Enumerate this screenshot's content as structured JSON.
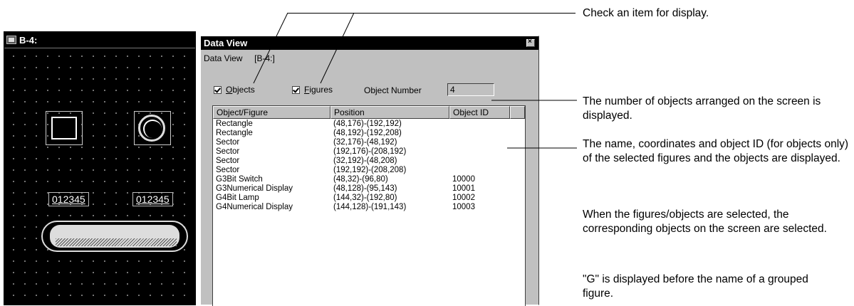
{
  "editor": {
    "title": "B-4:",
    "numerical_display_1": "012345",
    "numerical_display_2": "012345"
  },
  "dialog": {
    "title": "Data View",
    "path": "Data View     [B-4:]",
    "close_glyph": "×",
    "objects_label": "Objects",
    "objects_checked": true,
    "figures_label": "Figures",
    "figures_checked": true,
    "object_number_label": "Object Number",
    "object_number_value": "4",
    "columns": [
      "Object/Figure",
      "Position",
      "Object ID",
      ""
    ],
    "rows": [
      {
        "name": "Rectangle",
        "position": "(48,176)-(192,192)",
        "id": ""
      },
      {
        "name": "Rectangle",
        "position": "(48,192)-(192,208)",
        "id": ""
      },
      {
        "name": "Sector",
        "position": "(32,176)-(48,192)",
        "id": ""
      },
      {
        "name": "Sector",
        "position": "(192,176)-(208,192)",
        "id": ""
      },
      {
        "name": "Sector",
        "position": "(32,192)-(48,208)",
        "id": ""
      },
      {
        "name": "Sector",
        "position": "(192,192)-(208,208)",
        "id": ""
      },
      {
        "name": "G3Bit Switch",
        "position": "(48,32)-(96,80)",
        "id": "10000"
      },
      {
        "name": "G3Numerical Display",
        "position": "(48,128)-(95,143)",
        "id": "10001"
      },
      {
        "name": "G4Bit Lamp",
        "position": "(144,32)-(192,80)",
        "id": "10002"
      },
      {
        "name": "G4Numerical Display",
        "position": "(144,128)-(191,143)",
        "id": "10003"
      }
    ]
  },
  "annotations": {
    "check_item": "Check an item for display.",
    "object_count": "The number of objects arranged on the screen is displayed.",
    "list_desc": "The name, coordinates and object ID (for objects only) of the selected figures and the objects are displayed.",
    "selection_desc": "When the figures/objects are selected, the corresponding objects on the screen are selected.",
    "grouped_desc": "\"G\" is displayed before the name of a grouped figure."
  }
}
